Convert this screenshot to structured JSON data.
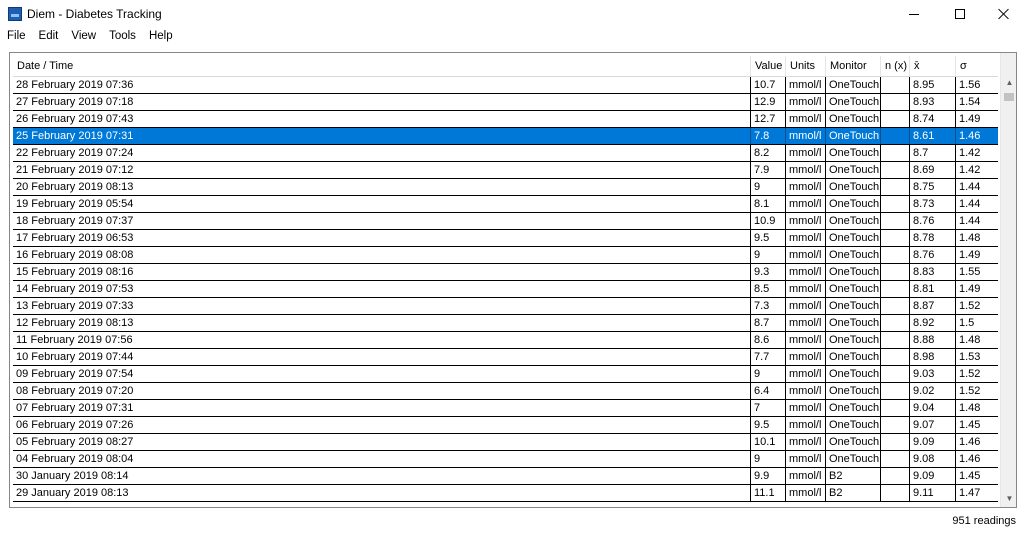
{
  "window": {
    "title": "Diem - Diabetes Tracking",
    "icon": "diem-app-icon"
  },
  "menu": [
    "File",
    "Edit",
    "View",
    "Tools",
    "Help"
  ],
  "table": {
    "headers": [
      "Date / Time",
      "Value",
      "Units",
      "Monitor",
      "n (x)",
      "x̄",
      "σ"
    ],
    "selected_index": 3,
    "rows": [
      [
        "28 February 2019 07:36",
        "10.7",
        "mmol/l",
        "OneTouch",
        "",
        "8.95",
        "1.56"
      ],
      [
        "27 February 2019 07:18",
        "12.9",
        "mmol/l",
        "OneTouch",
        "",
        "8.93",
        "1.54"
      ],
      [
        "26 February 2019 07:43",
        "12.7",
        "mmol/l",
        "OneTouch",
        "",
        "8.74",
        "1.49"
      ],
      [
        "25 February 2019 07:31",
        "7.8",
        "mmol/l",
        "OneTouch",
        "",
        "8.61",
        "1.46"
      ],
      [
        "22 February 2019 07:24",
        "8.2",
        "mmol/l",
        "OneTouch",
        "",
        "8.7",
        "1.42"
      ],
      [
        "21 February 2019 07:12",
        "7.9",
        "mmol/l",
        "OneTouch",
        "",
        "8.69",
        "1.42"
      ],
      [
        "20 February 2019 08:13",
        "9",
        "mmol/l",
        "OneTouch",
        "",
        "8.75",
        "1.44"
      ],
      [
        "19 February 2019 05:54",
        "8.1",
        "mmol/l",
        "OneTouch",
        "",
        "8.73",
        "1.44"
      ],
      [
        "18 February 2019 07:37",
        "10.9",
        "mmol/l",
        "OneTouch",
        "",
        "8.76",
        "1.44"
      ],
      [
        "17 February 2019 06:53",
        "9.5",
        "mmol/l",
        "OneTouch",
        "",
        "8.78",
        "1.48"
      ],
      [
        "16 February 2019 08:08",
        "9",
        "mmol/l",
        "OneTouch",
        "",
        "8.76",
        "1.49"
      ],
      [
        "15 February 2019 08:16",
        "9.3",
        "mmol/l",
        "OneTouch",
        "",
        "8.83",
        "1.55"
      ],
      [
        "14 February 2019 07:53",
        "8.5",
        "mmol/l",
        "OneTouch",
        "",
        "8.81",
        "1.49"
      ],
      [
        "13 February 2019 07:33",
        "7.3",
        "mmol/l",
        "OneTouch",
        "",
        "8.87",
        "1.52"
      ],
      [
        "12 February 2019 08:13",
        "8.7",
        "mmol/l",
        "OneTouch",
        "",
        "8.92",
        "1.5"
      ],
      [
        "11 February 2019 07:56",
        "8.6",
        "mmol/l",
        "OneTouch",
        "",
        "8.88",
        "1.48"
      ],
      [
        "10 February 2019 07:44",
        "7.7",
        "mmol/l",
        "OneTouch",
        "",
        "8.98",
        "1.53"
      ],
      [
        "09 February 2019 07:54",
        "9",
        "mmol/l",
        "OneTouch",
        "",
        "9.03",
        "1.52"
      ],
      [
        "08 February 2019 07:20",
        "6.4",
        "mmol/l",
        "OneTouch",
        "",
        "9.02",
        "1.52"
      ],
      [
        "07 February 2019 07:31",
        "7",
        "mmol/l",
        "OneTouch",
        "",
        "9.04",
        "1.48"
      ],
      [
        "06 February 2019 07:26",
        "9.5",
        "mmol/l",
        "OneTouch",
        "",
        "9.07",
        "1.45"
      ],
      [
        "05 February 2019 08:27",
        "10.1",
        "mmol/l",
        "OneTouch",
        "",
        "9.09",
        "1.46"
      ],
      [
        "04 February 2019 08:04",
        "9",
        "mmol/l",
        "OneTouch",
        "",
        "9.08",
        "1.46"
      ],
      [
        "30 January 2019 08:14",
        "9.9",
        "mmol/l",
        "B2",
        "",
        "9.09",
        "1.45"
      ],
      [
        "29 January 2019 08:13",
        "11.1",
        "mmol/l",
        "B2",
        "",
        "9.11",
        "1.47"
      ]
    ]
  },
  "status": {
    "readings": "951 readings"
  },
  "colors": {
    "selection": "#0078d7",
    "grid_line": "#000000"
  }
}
